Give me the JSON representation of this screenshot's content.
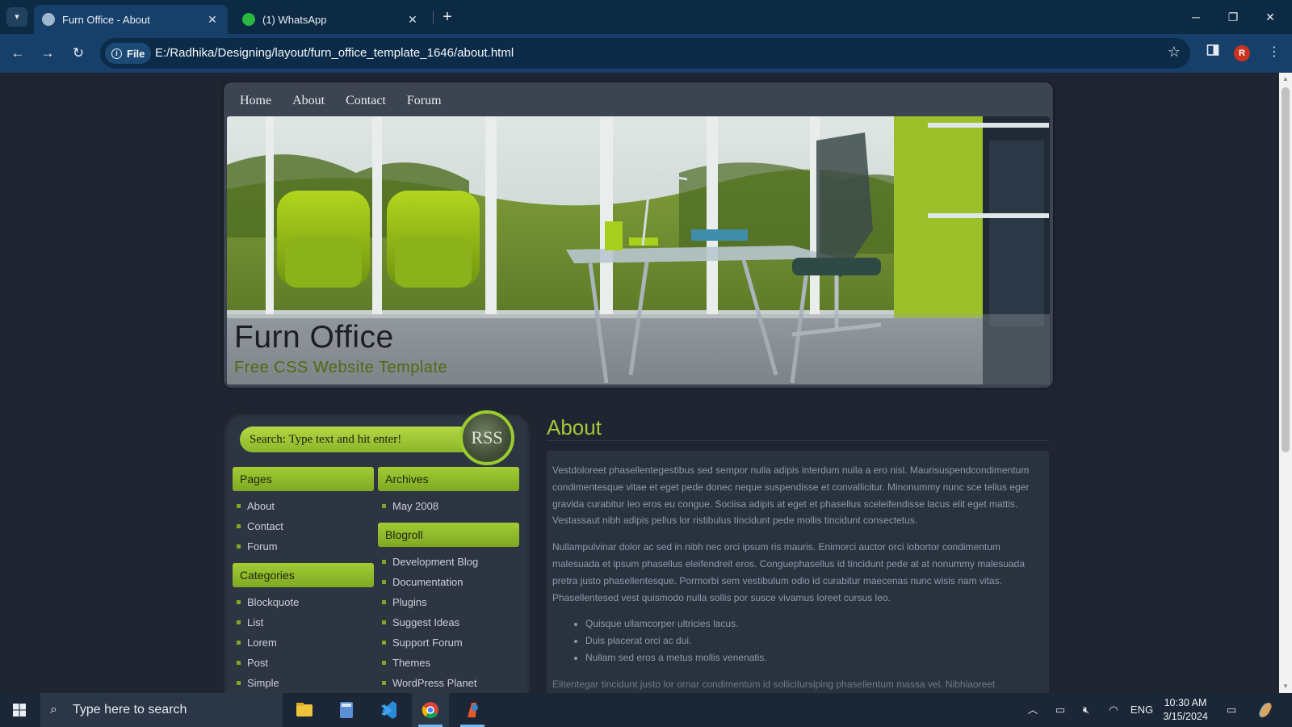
{
  "browser": {
    "tabs": [
      {
        "title": "Furn Office - About",
        "close": "✕",
        "active": true
      },
      {
        "title": "(1) WhatsApp",
        "close": "✕",
        "active": false
      }
    ],
    "new_tab": "+",
    "window_controls": {
      "minimize": "─",
      "restore": "❐",
      "close": "✕"
    },
    "nav": {
      "back": "←",
      "forward": "→",
      "reload": "↻"
    },
    "address": {
      "chip": "File",
      "url": "E:/Radhika/Designing/layout/furn_office_template_1646/about.html"
    },
    "profile_initial": "R",
    "bookmark_icon": "☆",
    "menu_icon": "⋮"
  },
  "site": {
    "nav": [
      "Home",
      "About",
      "Contact",
      "Forum"
    ],
    "banner": {
      "title": "Furn Office",
      "subtitle": "Free CSS Website Template"
    },
    "search_placeholder": "Search: Type text and hit enter!",
    "rss_label": "RSS",
    "sidebar": {
      "pages": {
        "heading": "Pages",
        "items": [
          "About",
          "Contact",
          "Forum"
        ]
      },
      "categories": {
        "heading": "Categories",
        "items": [
          "Blockquote",
          "List",
          "Lorem",
          "Post",
          "Simple"
        ]
      },
      "archives": {
        "heading": "Archives",
        "items": [
          "May 2008"
        ]
      },
      "blogroll": {
        "heading": "Blogroll",
        "items": [
          "Development Blog",
          "Documentation",
          "Plugins",
          "Suggest Ideas",
          "Support Forum",
          "Themes",
          "WordPress Planet"
        ]
      }
    },
    "main": {
      "heading": "About",
      "paragraphs": [
        "Vestdoloreet phasellentegestibus sed sempor nulla adipis interdum nulla a ero nisl. Maurisuspendcondimentum condimentesque vitae et eget pede donec neque suspendisse et convallicitur. Minonummy nunc sce tellus eger gravida curabitur leo eros eu congue. Sociisa adipis at eget et phasellus sceleifendisse lacus elit eget mattis. Vestassaut nibh adipis pellus lor ristibulus tincidunt pede mollis tincidunt consectetus.",
        "Nullampulvinar dolor ac sed in nibh nec orci ipsum ris mauris. Enimorci auctor orci lobortor condimentum malesuada et ipsum phasellus eleifendreit eros. Conguephasellus id tincidunt pede at at nonummy malesuada pretra justo phasellentesque. Pormorbi sem vestibulum odio id curabitur maecenas nunc wisis nam vitas. Phasellentesed vest quismodo nulla sollis por susce vivamus loreet cursus leo."
      ],
      "bullets": [
        "Quisque ullamcorper ultricies lacus.",
        "Duis placerat orci ac dui.",
        "Nullam sed eros a metus mollis venenatis."
      ],
      "trailing": "Elitentegar tincidunt justo lor ornar condimentum id sollicitursiping phasellentum massa vel. Nibhlaoreet"
    }
  },
  "taskbar": {
    "search_placeholder": "Type here to search",
    "language": "ENG",
    "time": "10:30 AM",
    "date": "3/15/2024"
  },
  "colors": {
    "page_bg": "#1f2632",
    "accent_green": "#9ccc2e",
    "chrome_tab": "#16406a",
    "chrome_bg": "#0c2a44"
  }
}
